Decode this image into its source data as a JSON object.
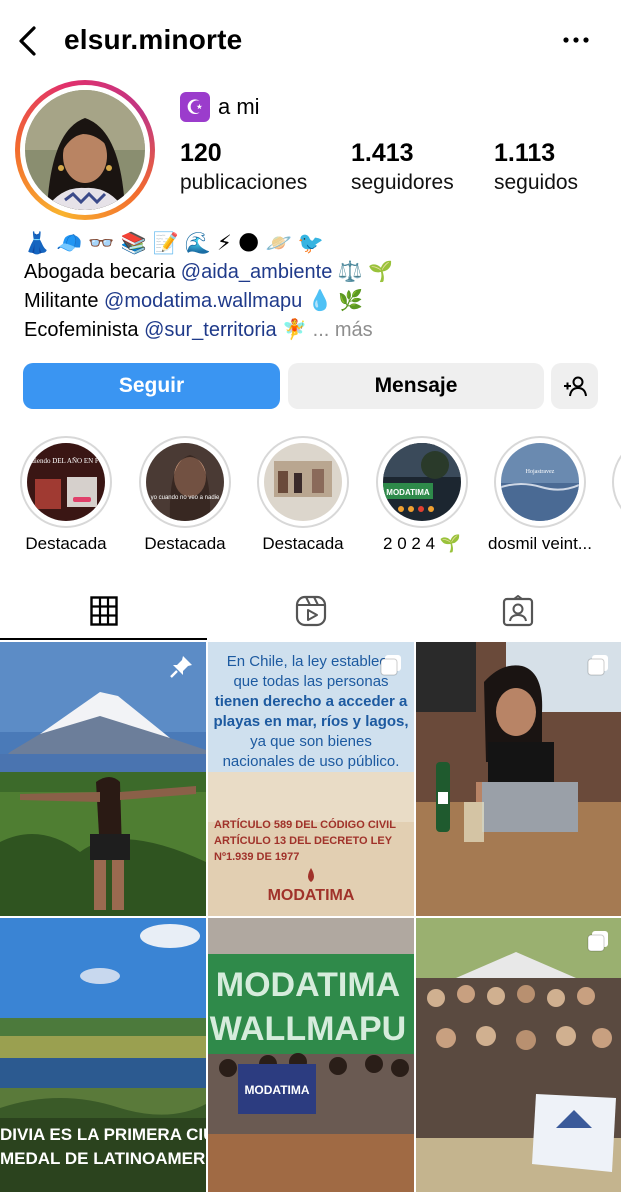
{
  "header": {
    "username": "elsur.minorte",
    "back_icon": "chevron-left-icon",
    "more_icon": "more-horizontal-icon"
  },
  "profile": {
    "symbol": "☪",
    "name": "a mi",
    "stats": [
      {
        "value": "120",
        "label": "publicaciones"
      },
      {
        "value": "1.413",
        "label": "seguidores"
      },
      {
        "value": "1.113",
        "label": "seguidos"
      }
    ]
  },
  "bio": {
    "emoji_line": [
      "👗",
      "🧢",
      "👓",
      "📚",
      "📝",
      "🌊",
      "⚡",
      "🌑",
      "🪐",
      "🐦"
    ],
    "line1_text": "Abogada becaria ",
    "line1_mention": "@aida_ambiente",
    "line1_emoji": " ⚖️ 🌱",
    "line2_text": "Militante ",
    "line2_mention": "@modatima.wallmapu",
    "line2_emoji": " 💧 🌿",
    "line3_text": "Ecofeminista ",
    "line3_mention": "@sur_territoria",
    "line3_emoji": " 🧚 ",
    "more": "... más"
  },
  "actions": {
    "follow": "Seguir",
    "message": "Mensaje",
    "add_user_icon": "add-person-icon"
  },
  "highlights": [
    {
      "label": "Destacada",
      "overlay": "Despidiendo DEL AÑO EN FOTOS"
    },
    {
      "label": "Destacada",
      "overlay": "yo cuando no veo a nadie"
    },
    {
      "label": "Destacada",
      "overlay": ""
    },
    {
      "label": "2 0 2 4 🌱",
      "overlay": "MODATIMA"
    },
    {
      "label": "dosmil veint...",
      "overlay": "Hojastravez"
    }
  ],
  "tabs": [
    "grid-icon",
    "reels-icon",
    "tagged-icon"
  ],
  "posts": [
    {
      "type": "photo",
      "text": "",
      "pinned": true
    },
    {
      "type": "graphic",
      "lines": [
        "En Chile, la ley establece",
        "que todas las personas",
        "tienen derecho a acceder a",
        "playas en mar, ríos y lagos,",
        "ya que son bienes",
        "nacionales de uso público."
      ],
      "bold_parts": [
        "derecho a acceder a",
        "playas en mar, ríos y lagos,"
      ],
      "article_lines": [
        "ARTÍCULO 589 DEL CÓDIGO CIVIL",
        "ARTÍCULO 13 DEL DECRETO LEY",
        "Nº1.939 DE 1977"
      ],
      "logo": "MODATIMA"
    },
    {
      "type": "photo",
      "text": ""
    },
    {
      "type": "photo",
      "caption": [
        "DIVIA ES LA PRIMERA CIU",
        "MEDAL DE LATINOAMERI"
      ]
    },
    {
      "type": "photo",
      "banner": [
        "MODATIMA",
        "WALLMAPU"
      ],
      "sign": "MODATIMA"
    },
    {
      "type": "photo",
      "text": ""
    }
  ]
}
